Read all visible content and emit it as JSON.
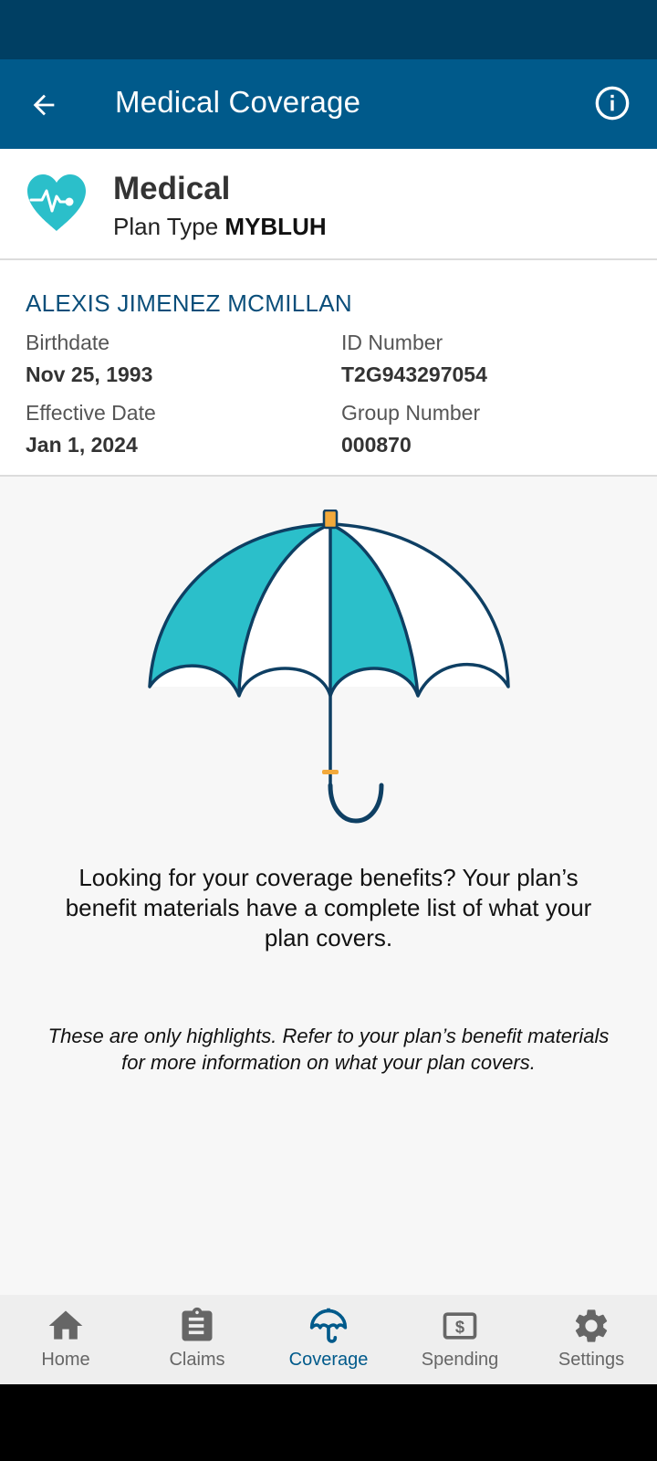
{
  "app_bar": {
    "title": "Medical Coverage"
  },
  "plan": {
    "name": "Medical",
    "type_label": "Plan Type",
    "type_value": "MYBLUH"
  },
  "member": {
    "name": "ALEXIS JIMENEZ MCMILLAN",
    "birthdate_label": "Birthdate",
    "birthdate": "Nov 25, 1993",
    "id_label": "ID Number",
    "id": "T2G943297054",
    "effective_label": "Effective Date",
    "effective": "Jan 1, 2024",
    "group_label": "Group Number",
    "group": "000870"
  },
  "content": {
    "lead": "Looking for your coverage benefits? Your plan’s benefit materials have a complete list of what your plan covers.",
    "note": "These are only highlights. Refer to your plan’s benefit materials for more information on what your plan covers."
  },
  "nav": {
    "items": [
      {
        "label": "Home",
        "icon": "home-icon",
        "active": false
      },
      {
        "label": "Claims",
        "icon": "clipboard-icon",
        "active": false
      },
      {
        "label": "Coverage",
        "icon": "umbrella-icon",
        "active": true
      },
      {
        "label": "Spending",
        "icon": "dollar-icon",
        "active": false
      },
      {
        "label": "Settings",
        "icon": "gear-icon",
        "active": false
      }
    ]
  },
  "colors": {
    "primary": "#005a8b",
    "status": "#003f63",
    "teal": "#2bbfca",
    "accent": "#f2a93b"
  }
}
